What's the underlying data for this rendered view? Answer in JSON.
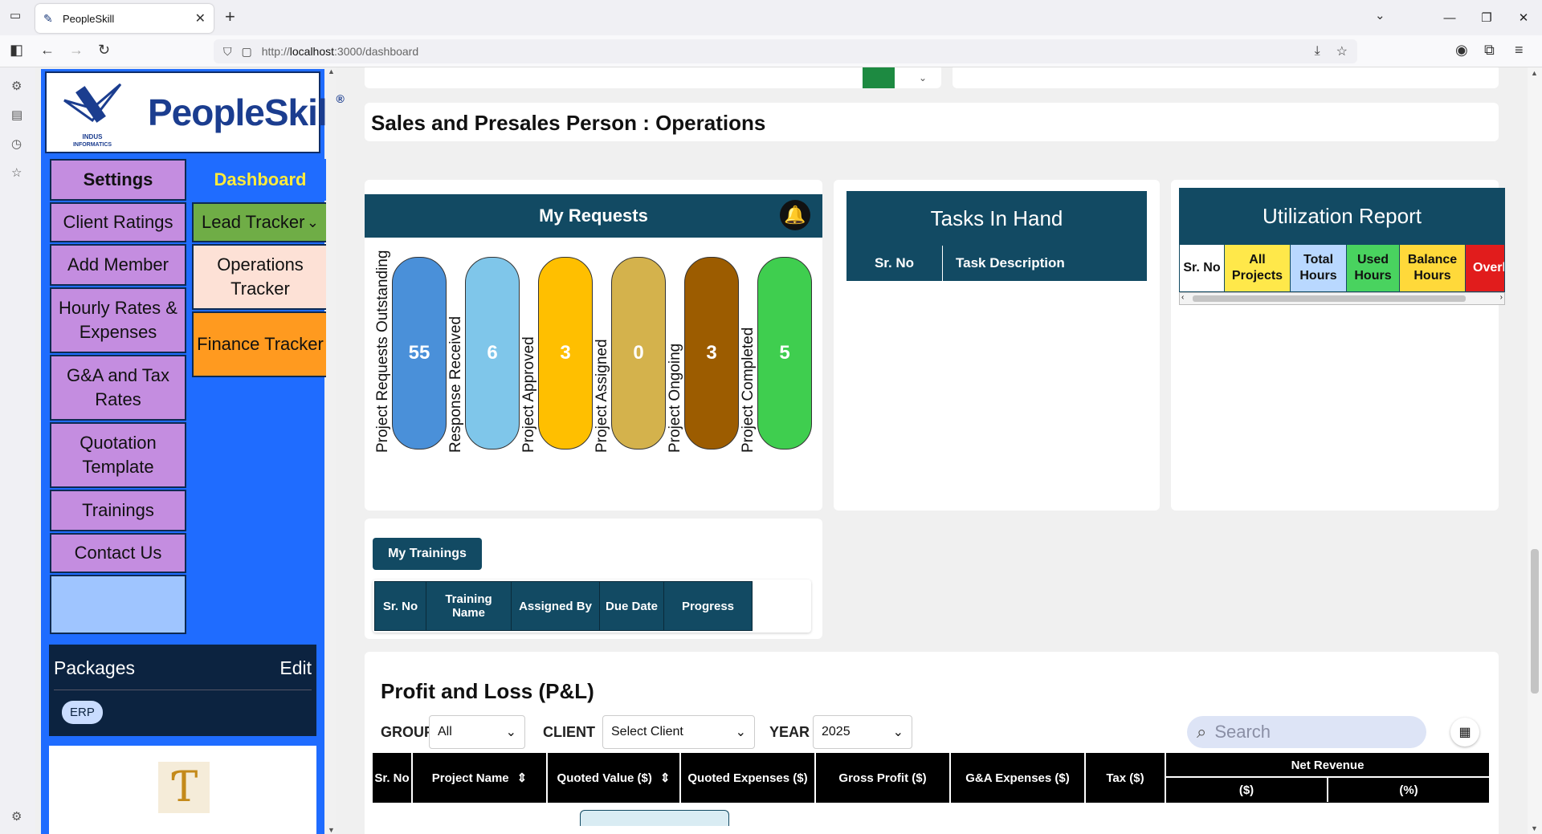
{
  "browser": {
    "tab_title": "PeopleSkill",
    "url_prefix": "http://",
    "url_host": "localhost",
    "url_rest": ":3000/dashboard"
  },
  "nav": {
    "logo_text": "PeopleSkill",
    "logo_reg": "®",
    "logo_sub": "INDUS INFORMATICS",
    "left_items": [
      "Settings",
      "Client Ratings",
      "Add Member",
      "Hourly Rates & Expenses",
      "G&A and Tax Rates",
      "Quotation Template",
      "Trainings",
      "Contact Us"
    ],
    "right_items": [
      "Dashboard",
      "Lead Tracker",
      "Operations Tracker",
      "Finance Tracker"
    ],
    "packages_title": "Packages",
    "packages_edit": "Edit",
    "package_chip": "ERP"
  },
  "section_title": "Sales and Presales Person : Operations",
  "my_requests": {
    "title": "My Requests",
    "items": [
      {
        "label": "Project Requests Outstanding",
        "value": "55",
        "color": "#4a90d9"
      },
      {
        "label": "Response Received",
        "value": "6",
        "color": "#7fc6ea"
      },
      {
        "label": "Project Approved",
        "value": "3",
        "color": "#ffbf00"
      },
      {
        "label": "Project Assigned",
        "value": "0",
        "color": "#d4b24c"
      },
      {
        "label": "Project Ongoing",
        "value": "3",
        "color": "#9c5c00"
      },
      {
        "label": "Project Completed",
        "value": "5",
        "color": "#3fce4f"
      }
    ]
  },
  "tasks": {
    "title": "Tasks In Hand",
    "col1": "Sr. No",
    "col2": "Task Description"
  },
  "utilization": {
    "title": "Utilization Report",
    "columns": [
      {
        "label": "Sr. No",
        "bg": "#ffffff",
        "fg": "#111"
      },
      {
        "label": "All Projects",
        "bg": "#ffe84a",
        "fg": "#111"
      },
      {
        "label": "Total Hours",
        "bg": "#b9d8ff",
        "fg": "#111"
      },
      {
        "label": "Used Hours",
        "bg": "#49d35f",
        "fg": "#111"
      },
      {
        "label": "Balance Hours",
        "bg": "#ffd93a",
        "fg": "#111"
      },
      {
        "label": "Overl",
        "bg": "#e11c1c",
        "fg": "#fff"
      }
    ]
  },
  "trainings": {
    "button": "My Trainings",
    "columns": [
      "Sr. No",
      "Training Name",
      "Assigned By",
      "Due Date",
      "Progress"
    ]
  },
  "pl": {
    "title": "Profit and Loss (P&L)",
    "group_label": "GROUP",
    "group_value": "All",
    "client_label": "CLIENT",
    "client_value": "Select Client",
    "year_label": "YEAR",
    "year_value": "2025",
    "search_placeholder": "Search",
    "columns": [
      "Sr. No",
      "Project Name",
      "Quoted Value ($)",
      "Quoted Expenses ($)",
      "Gross Profit ($)",
      "G&A Expenses ($)",
      "Tax ($)",
      "Net Revenue"
    ],
    "net_sub": [
      "($)",
      "(%)"
    ]
  }
}
